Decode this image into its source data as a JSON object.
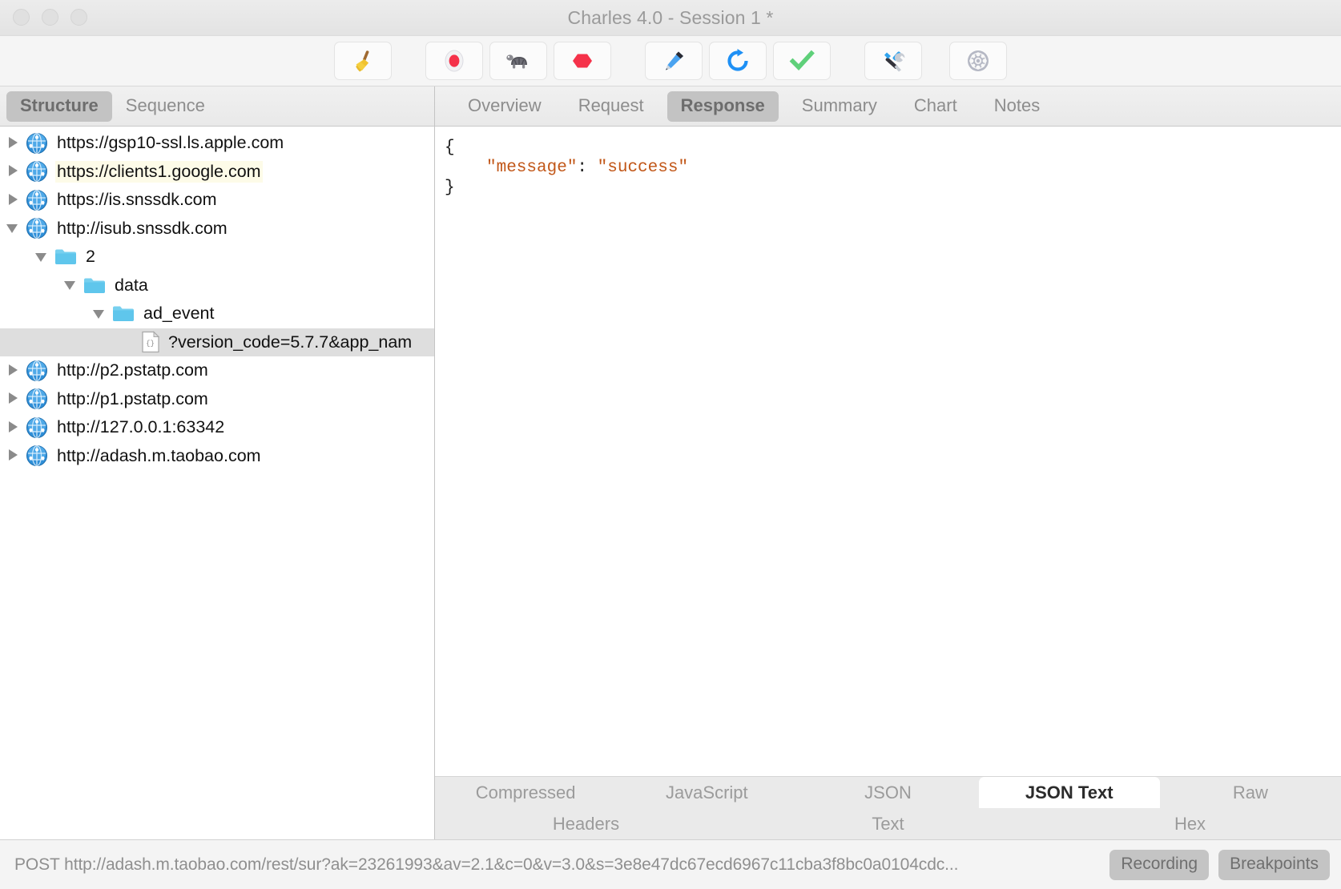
{
  "window": {
    "title": "Charles 4.0 - Session 1 *",
    "traffic_lights": [
      "close",
      "minimize",
      "zoom"
    ]
  },
  "toolbar": {
    "buttons": [
      {
        "name": "clear-session",
        "icon": "broom-icon",
        "glyph": "broom"
      },
      {
        "name": "start-stop-recording",
        "icon": "record-icon",
        "glyph": "record"
      },
      {
        "name": "throttling",
        "icon": "turtle-icon",
        "glyph": "turtle"
      },
      {
        "name": "breakpoints",
        "icon": "stop-hexagon-icon",
        "glyph": "hexagon"
      },
      {
        "name": "compose",
        "icon": "pen-icon",
        "glyph": "pen"
      },
      {
        "name": "repeat",
        "icon": "refresh-icon",
        "glyph": "refresh"
      },
      {
        "name": "validate",
        "icon": "checkmark-icon",
        "glyph": "check"
      },
      {
        "name": "tools",
        "icon": "tools-icon",
        "glyph": "tools"
      },
      {
        "name": "settings",
        "icon": "gear-icon",
        "glyph": "gear"
      }
    ]
  },
  "left_panel": {
    "tabs": [
      {
        "label": "Structure",
        "active": true
      },
      {
        "label": "Sequence",
        "active": false
      }
    ],
    "tree": [
      {
        "label": "https://gsp10-ssl.ls.apple.com",
        "icon": "globe-icon",
        "indent": 0,
        "state": "closed",
        "selected": false,
        "highlight": false
      },
      {
        "label": "https://clients1.google.com",
        "icon": "globe-icon",
        "indent": 0,
        "state": "closed",
        "selected": false,
        "highlight": true
      },
      {
        "label": "https://is.snssdk.com",
        "icon": "globe-icon",
        "indent": 0,
        "state": "closed",
        "selected": false,
        "highlight": false
      },
      {
        "label": "http://isub.snssdk.com",
        "icon": "globe-icon",
        "indent": 0,
        "state": "open",
        "selected": false,
        "highlight": false
      },
      {
        "label": "2",
        "icon": "folder-icon",
        "indent": 1,
        "state": "open",
        "selected": false,
        "highlight": false
      },
      {
        "label": "data",
        "icon": "folder-icon",
        "indent": 2,
        "state": "open",
        "selected": false,
        "highlight": false
      },
      {
        "label": "ad_event",
        "icon": "folder-icon",
        "indent": 3,
        "state": "open",
        "selected": false,
        "highlight": false
      },
      {
        "label": "?version_code=5.7.7&app_nam",
        "icon": "json-file-icon",
        "indent": 4,
        "state": "none",
        "selected": true,
        "highlight": false
      },
      {
        "label": "http://p2.pstatp.com",
        "icon": "globe-icon",
        "indent": 0,
        "state": "closed",
        "selected": false,
        "highlight": false
      },
      {
        "label": "http://p1.pstatp.com",
        "icon": "globe-icon",
        "indent": 0,
        "state": "closed",
        "selected": false,
        "highlight": false
      },
      {
        "label": "http://127.0.0.1:63342",
        "icon": "globe-icon",
        "indent": 0,
        "state": "closed",
        "selected": false,
        "highlight": false
      },
      {
        "label": "http://adash.m.taobao.com",
        "icon": "globe-icon",
        "indent": 0,
        "state": "closed",
        "selected": false,
        "highlight": false
      }
    ]
  },
  "right_panel": {
    "tabs": [
      {
        "label": "Overview",
        "active": false
      },
      {
        "label": "Request",
        "active": false
      },
      {
        "label": "Response",
        "active": true
      },
      {
        "label": "Summary",
        "active": false
      },
      {
        "label": "Chart",
        "active": false
      },
      {
        "label": "Notes",
        "active": false
      }
    ],
    "body": {
      "format": "JSON Text",
      "lines": [
        {
          "open_brace": "{"
        },
        {
          "key": "\"message\"",
          "colon": ":",
          "value": "\"success\""
        },
        {
          "close_brace": "}"
        }
      ],
      "raw": "{\n    \"message\": \"success\"\n}"
    },
    "bottom_tabs_row1": [
      {
        "label": "Compressed",
        "active": false
      },
      {
        "label": "JavaScript",
        "active": false
      },
      {
        "label": "JSON",
        "active": false
      },
      {
        "label": "JSON Text",
        "active": true
      },
      {
        "label": "Raw",
        "active": false
      }
    ],
    "bottom_tabs_row2": [
      {
        "label": "Headers",
        "active": false
      },
      {
        "label": "Text",
        "active": false
      },
      {
        "label": "Hex",
        "active": false
      }
    ]
  },
  "status_bar": {
    "text": "POST http://adash.m.taobao.com/rest/sur?ak=23261993&av=2.1&c=0&v=3.0&s=3e8e47dc67ecd6967c11cba3f8bc0a0104cdc...",
    "recording_label": "Recording",
    "breakpoints_label": "Breakpoints"
  },
  "colors": {
    "json_string": "#c15617",
    "selection": "#dedede",
    "highlight": "#fdfbe8",
    "tab_active": "#c3c3c3",
    "pill": "#c4c4c4"
  }
}
